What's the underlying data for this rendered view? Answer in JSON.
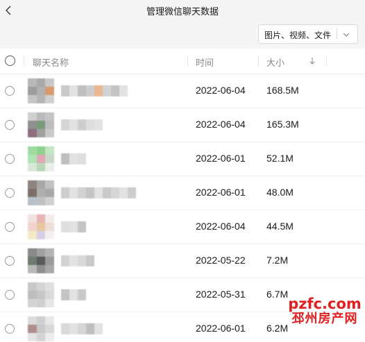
{
  "window": {
    "title": "管理微信聊天数据"
  },
  "icons": {
    "back": "back-chevron-icon",
    "dropdown": "chevron-down-icon",
    "sort": "sort-down-arrow-icon"
  },
  "filter": {
    "selected": "图片、视频、文件"
  },
  "table": {
    "columns": {
      "name": "聊天名称",
      "time": "时间",
      "size": "大小"
    },
    "rows": [
      {
        "date": "2022-06-04",
        "size": "168.5M"
      },
      {
        "date": "2022-06-04",
        "size": "165.3M"
      },
      {
        "date": "2022-06-01",
        "size": "52.1M"
      },
      {
        "date": "2022-06-01",
        "size": "48.0M"
      },
      {
        "date": "2022-06-04",
        "size": "44.5M"
      },
      {
        "date": "2022-05-22",
        "size": "7.2M"
      },
      {
        "date": "2022-05-31",
        "size": "6.7M"
      },
      {
        "date": "2022-06-01",
        "size": "6.2M"
      }
    ]
  },
  "watermark": {
    "line1": "pzfc.com",
    "line2": "邳州房产网"
  },
  "colors": {
    "titlebar_bg": "#f5f5f5",
    "watermark": "#e02020"
  }
}
